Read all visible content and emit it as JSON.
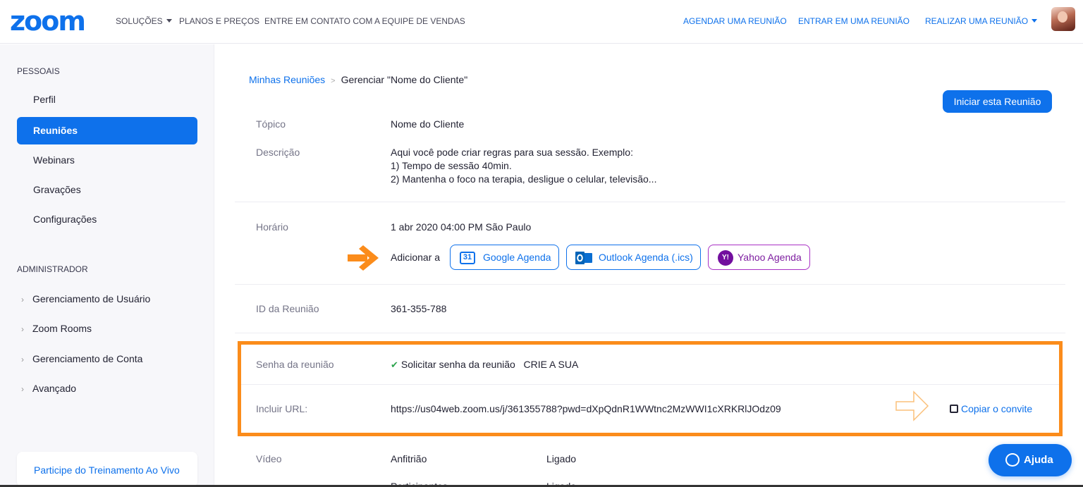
{
  "header": {
    "logo": "zoom",
    "nav_left": [
      "SOLUÇÕES",
      "PLANOS E PREÇOS",
      "ENTRE EM CONTATO COM A EQUIPE DE VENDAS"
    ],
    "nav_right": [
      "AGENDAR UMA REUNIÃO",
      "ENTRAR EM UMA REUNIÃO",
      "REALIZAR UMA REUNIÃO"
    ]
  },
  "sidebar": {
    "personal_title": "PESSOAIS",
    "personal_items": [
      "Perfil",
      "Reuniões",
      "Webinars",
      "Gravações",
      "Configurações"
    ],
    "active_item": "Reuniões",
    "admin_title": "ADMINISTRADOR",
    "admin_items": [
      "Gerenciamento de Usuário",
      "Zoom Rooms",
      "Gerenciamento de Conta",
      "Avançado"
    ],
    "training": "Participe do Treinamento Ao Vivo"
  },
  "breadcrumb": {
    "parent": "Minhas Reuniões",
    "separator": ">",
    "current": "Gerenciar \"Nome do Cliente\""
  },
  "start_button": "Iniciar esta Reunião",
  "meeting": {
    "topic_label": "Tópico",
    "topic": "Nome do Cliente",
    "description_label": "Descrição",
    "description_lines": [
      "Aqui você pode criar regras para sua sessão. Exemplo:",
      "1) Tempo de sessão 40min.",
      "2) Mantenha o foco na terapia, desligue o celular, televisão..."
    ],
    "time_label": "Horário",
    "time": "1 abr 2020 04:00 PM São Paulo",
    "add_to_label": "Adicionar a",
    "calendars": {
      "google": "Google Agenda",
      "google_icon_text": "31",
      "outlook": "Outlook Agenda (.ics)",
      "yahoo": "Yahoo Agenda",
      "yahoo_icon_text": "Y!"
    },
    "id_label": "ID da Reunião",
    "id": "361-355-788",
    "password_label": "Senha da reunião",
    "password_text": "Solicitar senha da reunião",
    "password_note": "CRIE A SUA",
    "url_label": "Incluir URL:",
    "url": "https://us04web.zoom.us/j/361355788?pwd=dXpQdnR1WWtnc2MzWWI1cXRKRlJOdz09",
    "copy_invite": "Copiar o convite",
    "video_label": "Vídeo",
    "video_host": "Anfitrião",
    "video_host_status": "Ligado",
    "video_participants": "Participantes",
    "video_participants_status": "Ligado"
  },
  "help_button": "Ajuda",
  "colors": {
    "brand": "#0e71eb",
    "highlight": "#fb8c1b",
    "yahoo": "#720e9e",
    "check": "#2da44e"
  }
}
